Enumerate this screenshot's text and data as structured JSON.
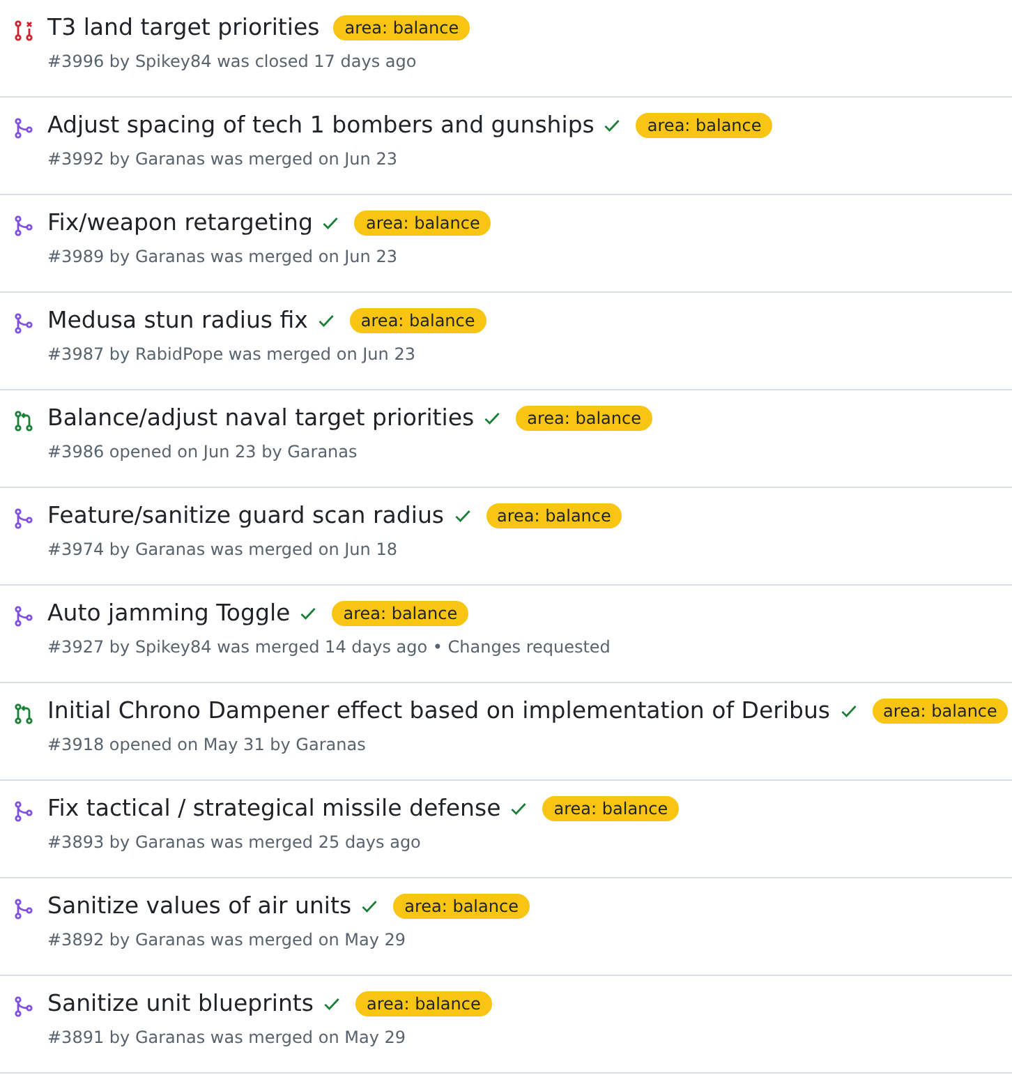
{
  "pull_requests": [
    {
      "kind": "closed",
      "title": "T3 land target priorities",
      "checks_passed": false,
      "labels": [
        {
          "text": "area: balance",
          "color": "#f9c513"
        }
      ],
      "meta": "#3996 by Spikey84 was closed 17 days ago"
    },
    {
      "kind": "merged",
      "title": "Adjust spacing of tech 1 bombers and gunships",
      "checks_passed": true,
      "labels": [
        {
          "text": "area: balance",
          "color": "#f9c513"
        }
      ],
      "meta": "#3992 by Garanas was merged on Jun 23"
    },
    {
      "kind": "merged",
      "title": "Fix/weapon retargeting",
      "checks_passed": true,
      "labels": [
        {
          "text": "area: balance",
          "color": "#f9c513"
        }
      ],
      "meta": "#3989 by Garanas was merged on Jun 23"
    },
    {
      "kind": "merged",
      "title": "Medusa stun radius fix",
      "checks_passed": true,
      "labels": [
        {
          "text": "area: balance",
          "color": "#f9c513"
        }
      ],
      "meta": "#3987 by RabidPope was merged on Jun 23"
    },
    {
      "kind": "open",
      "title": "Balance/adjust naval target priorities",
      "checks_passed": true,
      "labels": [
        {
          "text": "area: balance",
          "color": "#f9c513"
        }
      ],
      "meta": "#3986 opened on Jun 23 by Garanas"
    },
    {
      "kind": "merged",
      "title": "Feature/sanitize guard scan radius",
      "checks_passed": true,
      "labels": [
        {
          "text": "area: balance",
          "color": "#f9c513"
        }
      ],
      "meta": "#3974 by Garanas was merged on Jun 18"
    },
    {
      "kind": "merged",
      "title": "Auto jamming Toggle",
      "checks_passed": true,
      "labels": [
        {
          "text": "area: balance",
          "color": "#f9c513"
        }
      ],
      "meta": "#3927 by Spikey84 was merged 14 days ago • Changes requested"
    },
    {
      "kind": "open",
      "title": "Initial Chrono Dampener effect based on implementation of Deribus",
      "checks_passed": true,
      "labels": [
        {
          "text": "area: balance",
          "color": "#f9c513"
        }
      ],
      "meta": "#3918 opened on May 31 by Garanas"
    },
    {
      "kind": "merged",
      "title": "Fix tactical / strategical missile defense",
      "checks_passed": true,
      "labels": [
        {
          "text": "area: balance",
          "color": "#f9c513"
        }
      ],
      "meta": "#3893 by Garanas was merged 25 days ago"
    },
    {
      "kind": "merged",
      "title": "Sanitize values of air units",
      "checks_passed": true,
      "labels": [
        {
          "text": "area: balance",
          "color": "#f9c513"
        }
      ],
      "meta": "#3892 by Garanas was merged on May 29"
    },
    {
      "kind": "merged",
      "title": "Sanitize unit blueprints",
      "checks_passed": true,
      "labels": [
        {
          "text": "area: balance",
          "color": "#f9c513"
        }
      ],
      "meta": "#3891 by Garanas was merged on May 29"
    }
  ]
}
